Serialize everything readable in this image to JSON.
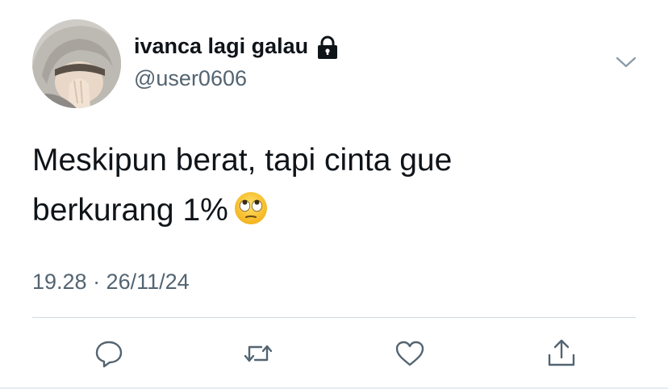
{
  "tweet": {
    "display_name": "ivanca lagi galau",
    "handle": "@user0606",
    "protected_icon": "lock-icon",
    "text_line1": "Meskipun berat, tapi cinta gue",
    "text_line2": "berkurang 1%",
    "emoji": "face-with-rolling-eyes",
    "timestamp": "19.28 · 26/11/24"
  },
  "actions": [
    {
      "name": "reply",
      "icon": "speech-bubble-icon"
    },
    {
      "name": "retweet",
      "icon": "retweet-arrows-icon"
    },
    {
      "name": "like",
      "icon": "heart-icon"
    },
    {
      "name": "share",
      "icon": "share-upload-icon"
    }
  ],
  "colors": {
    "primary_text": "#0f1419",
    "secondary_text": "#536471",
    "divider": "#cfd9de",
    "icon": "#536471"
  }
}
